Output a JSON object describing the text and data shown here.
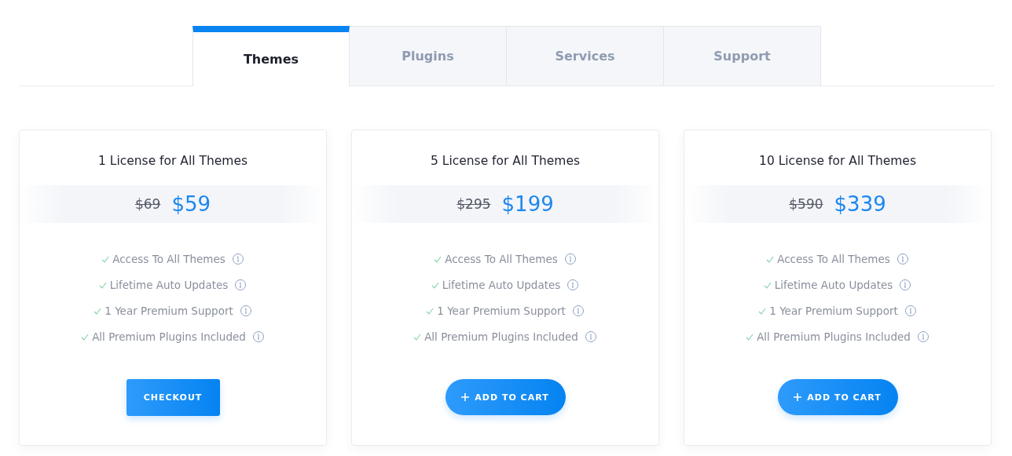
{
  "tabs": [
    {
      "label": "Themes",
      "selected": true
    },
    {
      "label": "Plugins",
      "selected": false
    },
    {
      "label": "Services",
      "selected": false
    },
    {
      "label": "Support",
      "selected": false
    }
  ],
  "plans": [
    {
      "title": "1 License for All Themes",
      "old_price": "$69",
      "price": "$59",
      "features": [
        "Access To All Themes",
        "Lifetime Auto Updates",
        "1 Year Premium Support",
        "All Premium Plugins Included"
      ],
      "button": {
        "kind": "square",
        "label": "CHECKOUT"
      }
    },
    {
      "title": "5 License for All Themes",
      "old_price": "$295",
      "price": "$199",
      "features": [
        "Access To All Themes",
        "Lifetime Auto Updates",
        "1 Year Premium Support",
        "All Premium Plugins Included"
      ],
      "button": {
        "kind": "pill",
        "label": "ADD TO CART"
      }
    },
    {
      "title": "10 License for All Themes",
      "old_price": "$590",
      "price": "$339",
      "features": [
        "Access To All Themes",
        "Lifetime Auto Updates",
        "1 Year Premium Support",
        "All Premium Plugins Included"
      ],
      "button": {
        "kind": "pill",
        "label": "ADD TO CART"
      }
    }
  ]
}
